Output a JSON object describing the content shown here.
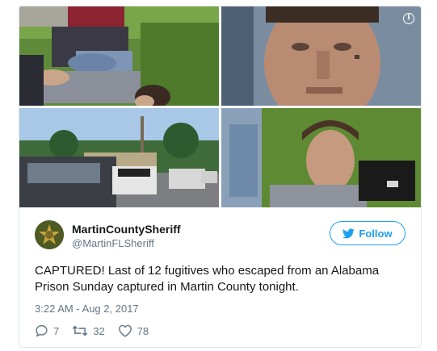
{
  "tweet": {
    "display_name": "MartinCountySheriff",
    "handle": "@MartinFLSheriff",
    "follow_label": "Follow",
    "text": "CAPTURED! Last of 12 fugitives who escaped from an Alabama Prison Sunday captured in Martin County tonight.",
    "timestamp": "3:22 AM - Aug 2, 2017",
    "replies": "7",
    "retweets": "32",
    "likes": "78"
  },
  "icons": {
    "info": "info-icon",
    "follow": "twitter-bird-icon",
    "reply": "reply-icon",
    "retweet": "retweet-icon",
    "like": "heart-icon"
  },
  "colors": {
    "accent": "#1da1f2",
    "secondary_text": "#657786",
    "border": "#e1e8ed"
  }
}
